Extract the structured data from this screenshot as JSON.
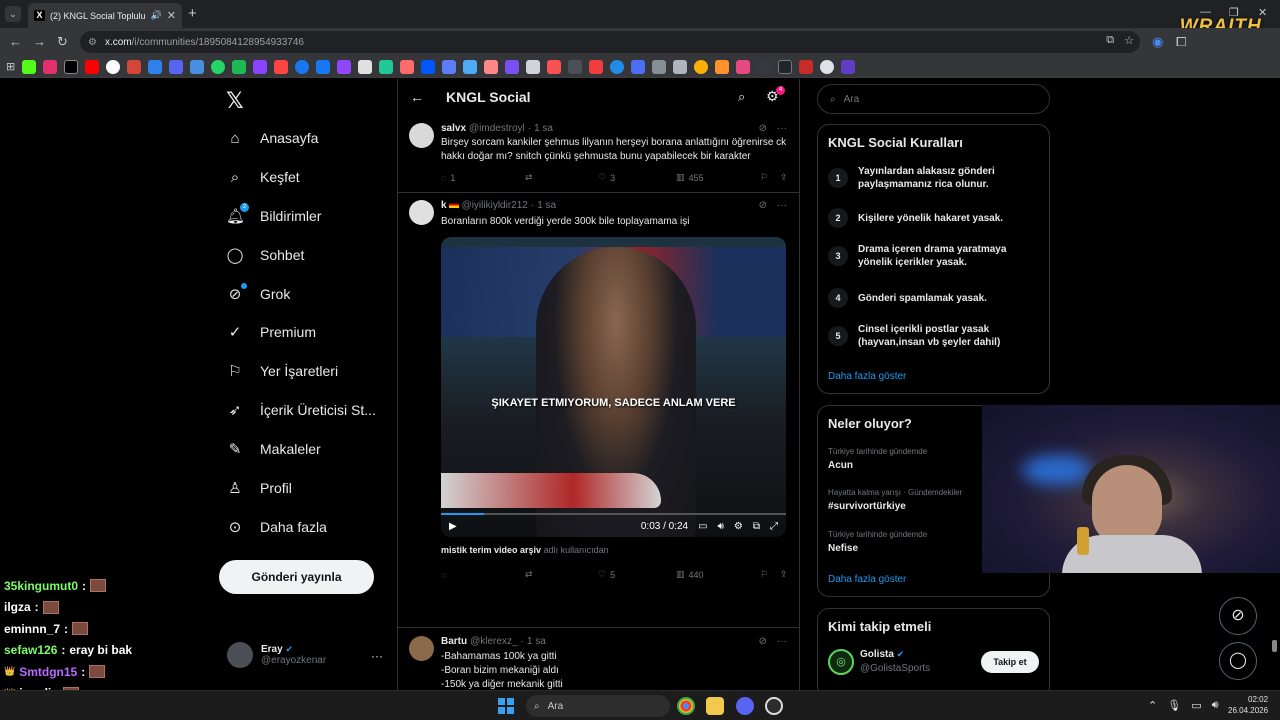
{
  "browser": {
    "tab_title": "(2) KNGL Social Topluluk / X",
    "url_host": "x.com",
    "url_path": "/i/communities/1895084128954933746",
    "overlay_brand": "WRAITH."
  },
  "nav": {
    "items": [
      {
        "label": "Anasayfa",
        "icon": "home-icon"
      },
      {
        "label": "Keşfet",
        "icon": "search-icon"
      },
      {
        "label": "Bildirimler",
        "icon": "bell-icon",
        "badge": "2"
      },
      {
        "label": "Sohbet",
        "icon": "chat-icon"
      },
      {
        "label": "Grok",
        "icon": "grok-icon"
      },
      {
        "label": "Premium",
        "icon": "verified-icon"
      },
      {
        "label": "Yer İşaretleri",
        "icon": "bookmark-icon"
      },
      {
        "label": "İçerik Üreticisi St...",
        "icon": "rocket-icon"
      },
      {
        "label": "Makaleler",
        "icon": "article-icon"
      },
      {
        "label": "Profil",
        "icon": "person-icon"
      },
      {
        "label": "Daha fazla",
        "icon": "more-circle-icon"
      }
    ],
    "post_button": "Gönderi yayınla",
    "account": {
      "name": "Eray",
      "handle": "@erayozkenar"
    }
  },
  "chat": [
    {
      "user": "35kingumut0",
      "color": "#7cfc6a",
      "message": ""
    },
    {
      "user": "ilgza",
      "color": "#ffffff",
      "message": ""
    },
    {
      "user": "eminnn_7",
      "color": "#ffffff",
      "message": ""
    },
    {
      "user": "sefaw126",
      "color": "#7cfc6a",
      "message": "eray bi bak"
    },
    {
      "user": "Smtdgn15",
      "color": "#b86cff",
      "message": ""
    },
    {
      "user": "iremli",
      "color": "#ffffff",
      "message": ""
    },
    {
      "user": "monatlich",
      "color": "#ffffff",
      "message": ""
    }
  ],
  "main": {
    "title": "KNGL Social",
    "header_badge": "4",
    "tweets": [
      {
        "name": "salvx",
        "handle": "@imdestroyl",
        "time": "1 sa",
        "text": "Birşey sorcam kankiler şehmus lilyanın herşeyi borana anlattığını öğrenirse ck hakkı doğar mı? snitch çünkü şehmusta bunu yapabilecek bir karakter",
        "replies": "1",
        "retweets": "",
        "likes": "3",
        "views": "455"
      },
      {
        "name": "k",
        "handle": "@iyilikiyldir212",
        "time": "1 sa",
        "text": "Boranların 800k verdiği yerde 300k bile toplayamama işi",
        "video_subtitle": "ŞIKAYET ETMIYORUM, SADECE ANLAM VERE",
        "video_time": "0:03 / 0:24",
        "video_progress": 0.125,
        "video_caption_user": "mistik terim video arşiv",
        "video_caption_suffix": "adlı kullanıcıdan",
        "replies": "",
        "retweets": "",
        "likes": "5",
        "views": "440"
      },
      {
        "name": "Bartu",
        "handle": "@klerexz_",
        "time": "1 sa",
        "text": "-Bahamamas 100k ya gitti\n-Boran bizim mekaniği aldı\n-150k ya diğer mekanik gitti"
      }
    ]
  },
  "right": {
    "search_placeholder": "Ara",
    "rules_title": "KNGL Social Kuralları",
    "rules": [
      {
        "num": "1",
        "text": "Yayınlardan alakasız gönderi paylaşmamanız rica olunur."
      },
      {
        "num": "2",
        "text": "Kişilere yönelik hakaret yasak."
      },
      {
        "num": "3",
        "text": "Drama içeren drama yaratmaya yönelik içerikler yasak."
      },
      {
        "num": "4",
        "text": "Gönderi spamlamak yasak."
      },
      {
        "num": "5",
        "text": "Cinsel içerikli postlar yasak (hayvan,insan vb şeyler dahil)"
      }
    ],
    "show_more": "Daha fazla göster",
    "trends_title": "Neler oluyor?",
    "trends": [
      {
        "category": "Türkiye tarihinde gündemde",
        "name": "Acun"
      },
      {
        "category": "Hayatta kalma yarışı · Gündemdekiler",
        "name": "#survivortürkiye"
      },
      {
        "category": "Türkiye tarihinde gündemde",
        "name": "Nefise"
      }
    ],
    "trends_more": "Daha fazla göster",
    "who_title": "Kimi takip etmeli",
    "who": {
      "name": "Golista",
      "handle": "@GolistaSports",
      "button": "Takip et"
    }
  },
  "taskbar": {
    "search": "Ara",
    "time": "02:02",
    "date": "26.04.2026"
  }
}
